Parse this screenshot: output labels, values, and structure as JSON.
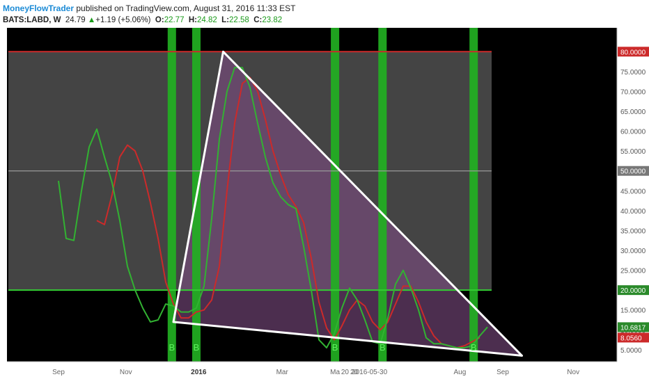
{
  "header": {
    "author": "MoneyFlowTrader",
    "published_text": "published on TradingView.com, August 31, 2016 11:33 EST",
    "symbol": "BATS:LABD, W",
    "last": "24.79",
    "change": "+1.19 (+5.06%)",
    "open_label": "O:",
    "open": "22.77",
    "high_label": "H:",
    "high": "24.82",
    "low_label": "L:",
    "low": "22.58",
    "close_label": "C:",
    "close": "23.82",
    "up_arrow": "▲"
  },
  "colors": {
    "background": "#000000",
    "zone": "#505050",
    "triangle_fill": "#7a4a80",
    "green_bar": "#22b022",
    "fast_line": "#32b232",
    "slow_line": "#cc2a2a",
    "level_80": "#cc2a2a",
    "level_20": "#33cc33",
    "level_50": "#9a9a9a"
  },
  "chart_data": {
    "type": "line",
    "x_ticks": [
      {
        "t": 1,
        "label": "Sep"
      },
      {
        "t": 9.8,
        "label": "Nov"
      },
      {
        "t": 19.3,
        "label": "2016"
      },
      {
        "t": 30.2,
        "label": "Mar"
      },
      {
        "t": 37.1,
        "label": "Ma"
      },
      {
        "t": 38.4,
        "label": "20"
      },
      {
        "t": 39.6,
        "label": "20"
      },
      {
        "t": 41.6,
        "label": "2016-05-30"
      },
      {
        "t": 53.4,
        "label": "Aug"
      },
      {
        "t": 59.0,
        "label": "Sep"
      },
      {
        "t": 68.2,
        "label": "Nov"
      }
    ],
    "y_ticks": [
      5,
      10,
      15,
      20,
      25,
      30,
      35,
      40,
      45,
      50,
      55,
      60,
      65,
      70,
      75,
      80
    ],
    "y_tick_labels": [
      "5.0000",
      "10.0000",
      "15.0000",
      "20.0000",
      "25.0000",
      "30.0000",
      "35.0000",
      "40.0000",
      "45.0000",
      "50.0000",
      "55.0000",
      "60.0000",
      "65.0000",
      "70.0000",
      "75.0000",
      "80.0000"
    ],
    "ylim": [
      2,
      86
    ],
    "levels": [
      {
        "value": 80,
        "label": "80.0000"
      },
      {
        "value": 50,
        "label": "50.0000"
      },
      {
        "value": 20,
        "label": "20.0000"
      }
    ],
    "last_values": [
      {
        "value": 10.6817,
        "label": "10.6817",
        "series": "fast"
      },
      {
        "value": 8.056,
        "label": "8.0560",
        "series": "slow"
      }
    ],
    "buy_bars": [
      {
        "t": 15.8,
        "label": "B"
      },
      {
        "t": 19.0,
        "label": "B"
      },
      {
        "t": 37.1,
        "label": "B"
      },
      {
        "t": 43.3,
        "label": "B"
      },
      {
        "t": 55.2,
        "label": "B"
      }
    ],
    "triangle": [
      [
        16.0,
        12.0
      ],
      [
        22.5,
        80.0
      ],
      [
        61.5,
        3.5
      ]
    ],
    "series": [
      {
        "key": "fast",
        "points": [
          [
            1,
            47.5
          ],
          [
            2,
            33
          ],
          [
            3,
            32.5
          ],
          [
            4,
            45
          ],
          [
            5,
            56
          ],
          [
            6,
            60.5
          ],
          [
            7,
            53.5
          ],
          [
            8,
            47
          ],
          [
            9,
            37.5
          ],
          [
            10,
            26
          ],
          [
            11,
            20
          ],
          [
            12,
            15.5
          ],
          [
            13,
            12
          ],
          [
            14,
            12.5
          ],
          [
            15,
            16.5
          ],
          [
            16,
            16
          ],
          [
            17,
            14.5
          ],
          [
            18,
            14.5
          ],
          [
            19,
            15.5
          ],
          [
            20,
            21
          ],
          [
            21,
            38
          ],
          [
            22,
            58
          ],
          [
            23,
            70
          ],
          [
            24,
            76
          ],
          [
            25,
            76
          ],
          [
            26,
            71
          ],
          [
            27,
            62
          ],
          [
            28,
            53.5
          ],
          [
            29,
            47
          ],
          [
            30,
            43.5
          ],
          [
            31,
            41.5
          ],
          [
            32,
            40.5
          ],
          [
            33,
            31
          ],
          [
            34,
            20
          ],
          [
            35,
            7.5
          ],
          [
            36,
            5.5
          ],
          [
            37,
            9
          ],
          [
            38,
            15.5
          ],
          [
            39,
            20.5
          ],
          [
            40,
            17.5
          ],
          [
            41,
            12.5
          ],
          [
            42,
            7
          ],
          [
            43,
            6.5
          ],
          [
            44,
            13
          ],
          [
            45,
            21.5
          ],
          [
            46,
            25
          ],
          [
            47,
            20.5
          ],
          [
            48,
            15
          ],
          [
            49,
            8
          ],
          [
            50,
            6.5
          ],
          [
            51,
            6.5
          ],
          [
            52,
            6
          ],
          [
            53,
            5.5
          ],
          [
            54,
            5.5
          ],
          [
            55,
            6
          ],
          [
            56,
            8.5
          ],
          [
            57,
            10.7
          ]
        ]
      },
      {
        "key": "slow",
        "points": [
          [
            6,
            37.5
          ],
          [
            7,
            36.5
          ],
          [
            8,
            44
          ],
          [
            9,
            53.5
          ],
          [
            10,
            56.5
          ],
          [
            11,
            55
          ],
          [
            12,
            50
          ],
          [
            13,
            42
          ],
          [
            14,
            33
          ],
          [
            15,
            22
          ],
          [
            16,
            16.5
          ],
          [
            17,
            13
          ],
          [
            18,
            13
          ],
          [
            19,
            14.5
          ],
          [
            20,
            15
          ],
          [
            21,
            17.5
          ],
          [
            22,
            26
          ],
          [
            23,
            45
          ],
          [
            24,
            62
          ],
          [
            25,
            72
          ],
          [
            26,
            73.5
          ],
          [
            27,
            70
          ],
          [
            28,
            63
          ],
          [
            29,
            55
          ],
          [
            30,
            49
          ],
          [
            31,
            44
          ],
          [
            32,
            41
          ],
          [
            33,
            37
          ],
          [
            34,
            28
          ],
          [
            35,
            17
          ],
          [
            36,
            10.5
          ],
          [
            37,
            7.5
          ],
          [
            38,
            11
          ],
          [
            39,
            15
          ],
          [
            40,
            17.5
          ],
          [
            41,
            16
          ],
          [
            42,
            12
          ],
          [
            43,
            10
          ],
          [
            44,
            12
          ],
          [
            45,
            16.5
          ],
          [
            46,
            21
          ],
          [
            47,
            21
          ],
          [
            48,
            17
          ],
          [
            49,
            12
          ],
          [
            50,
            8.5
          ],
          [
            51,
            6.5
          ],
          [
            52,
            6
          ],
          [
            53,
            5.5
          ],
          [
            54,
            6
          ],
          [
            55,
            7
          ],
          [
            56,
            8.06
          ]
        ]
      }
    ]
  }
}
